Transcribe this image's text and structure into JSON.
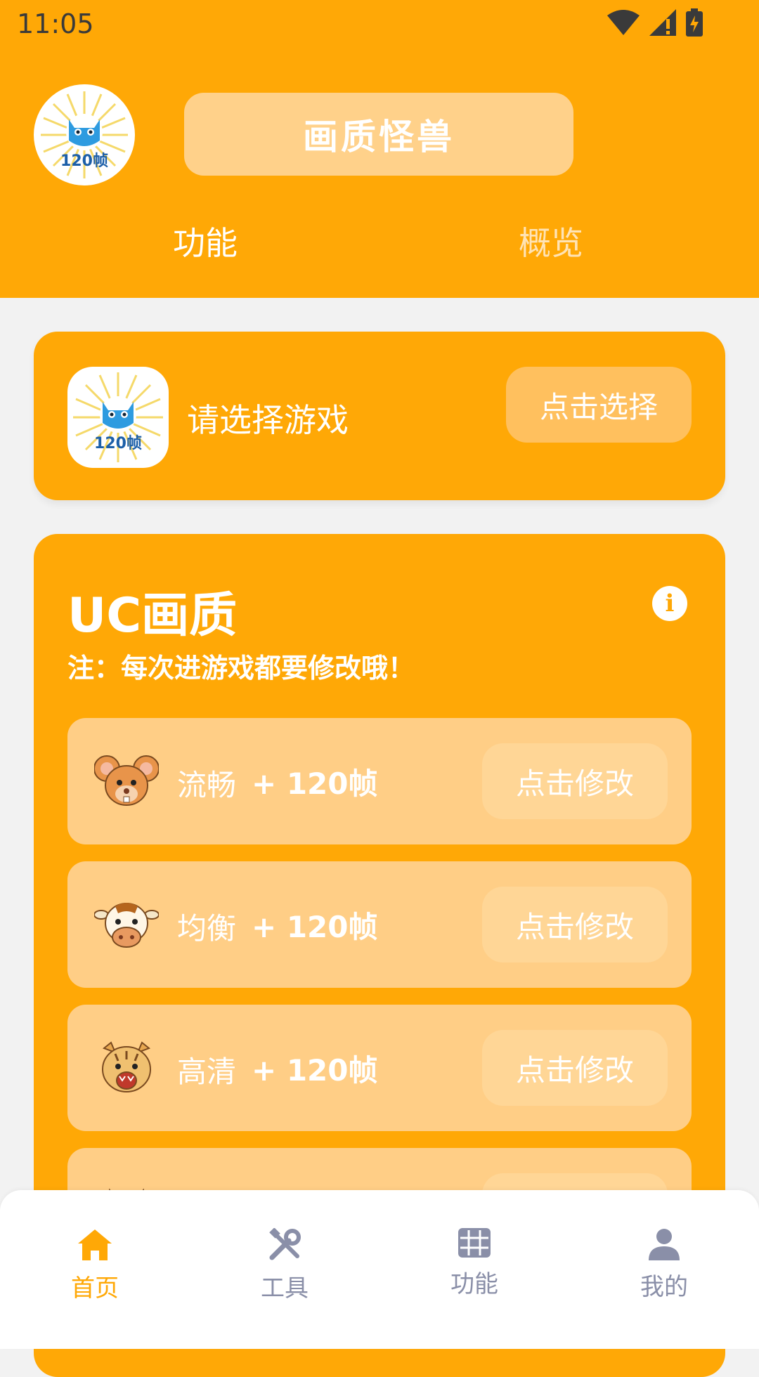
{
  "status_bar": {
    "time": "11:05"
  },
  "header": {
    "logo_text": "120帧",
    "title": "画质怪兽",
    "tabs": [
      {
        "label": "功能",
        "active": true
      },
      {
        "label": "概览",
        "active": false
      }
    ]
  },
  "game_select": {
    "icon_text": "120帧",
    "prompt": "请选择游戏",
    "button_label": "点击选择"
  },
  "uc_quality": {
    "title": "UC画质",
    "note": "注：每次进游戏都要修改哦！",
    "options": [
      {
        "name": "流畅",
        "boost": "+ 120帧",
        "button": "点击修改",
        "avatar": "mouse-icon"
      },
      {
        "name": "均衡",
        "boost": "+ 120帧",
        "button": "点击修改",
        "avatar": "cow-icon"
      },
      {
        "name": "高清",
        "boost": "+ 120帧",
        "button": "点击修改",
        "avatar": "tiger-icon"
      }
    ]
  },
  "bottom_nav": {
    "items": [
      {
        "label": "首页",
        "icon": "home-icon",
        "active": true
      },
      {
        "label": "工具",
        "icon": "tools-icon",
        "active": false
      },
      {
        "label": "功能",
        "icon": "grid-icon",
        "active": false
      },
      {
        "label": "我的",
        "icon": "person-icon",
        "active": false
      }
    ]
  },
  "colors": {
    "primary": "#FFA806",
    "pill": "#FFD18A",
    "row": "#FFCE86",
    "inactive_nav": "#8A8FA8"
  }
}
